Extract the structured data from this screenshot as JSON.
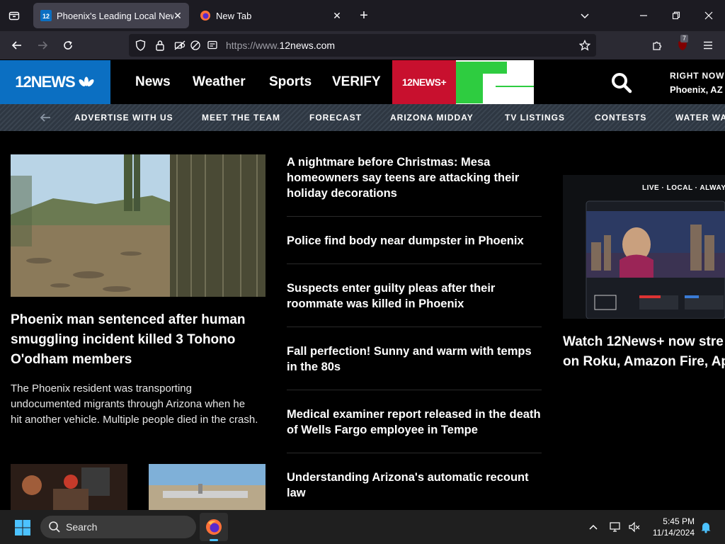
{
  "browser": {
    "tabs": [
      {
        "title": "Phoenix's Leading Local News:",
        "active": true
      },
      {
        "title": "New Tab",
        "active": false
      }
    ],
    "new_tab_symbol": "+",
    "url_scheme": "https://www.",
    "url_host": "12news.com",
    "extension_badge": "7"
  },
  "site": {
    "logo_text": "12NEWS",
    "nav": [
      "News",
      "Weather",
      "Sports",
      "VERIFY"
    ],
    "promo_logo_text": "12NEWS+",
    "right_now_label": "RIGHT NOW",
    "right_now_location": "Phoenix, AZ",
    "subnav": [
      "ADVERTISE WITH US",
      "MEET THE TEAM",
      "FORECAST",
      "ARIZONA MIDDAY",
      "TV LISTINGS",
      "CONTESTS",
      "WATER WA"
    ]
  },
  "hero": {
    "title": "Phoenix man sentenced after human smuggling incident killed 3 Tohono O'odham members",
    "description": "The Phoenix resident was transporting undocumented migrants through Arizona when he hit another vehicle. Multiple people died in the crash."
  },
  "stories": [
    "A nightmare before Christmas: Mesa homeowners say teens are attacking their holiday decorations",
    "Police find body near dumpster in Phoenix",
    "Suspects enter guilty pleas after their roommate was killed in Phoenix",
    "Fall perfection! Sunny and warm with temps in the 80s",
    "Medical examiner report released in the death of Wells Fargo employee in Tempe",
    "Understanding Arizona's automatic recount law"
  ],
  "promo": {
    "banner": "LIVE · LOCAL · ALWAYS",
    "title_line1": "Watch 12News+ now stre",
    "title_line2": "on Roku, Amazon Fire, Ap"
  },
  "taskbar": {
    "search_label": "Search",
    "time": "5:45 PM",
    "date": "11/14/2024"
  },
  "colors": {
    "logo_blue": "#0b6fc2",
    "promo_red": "#c8102e",
    "promo_green": "#2ecc40"
  }
}
